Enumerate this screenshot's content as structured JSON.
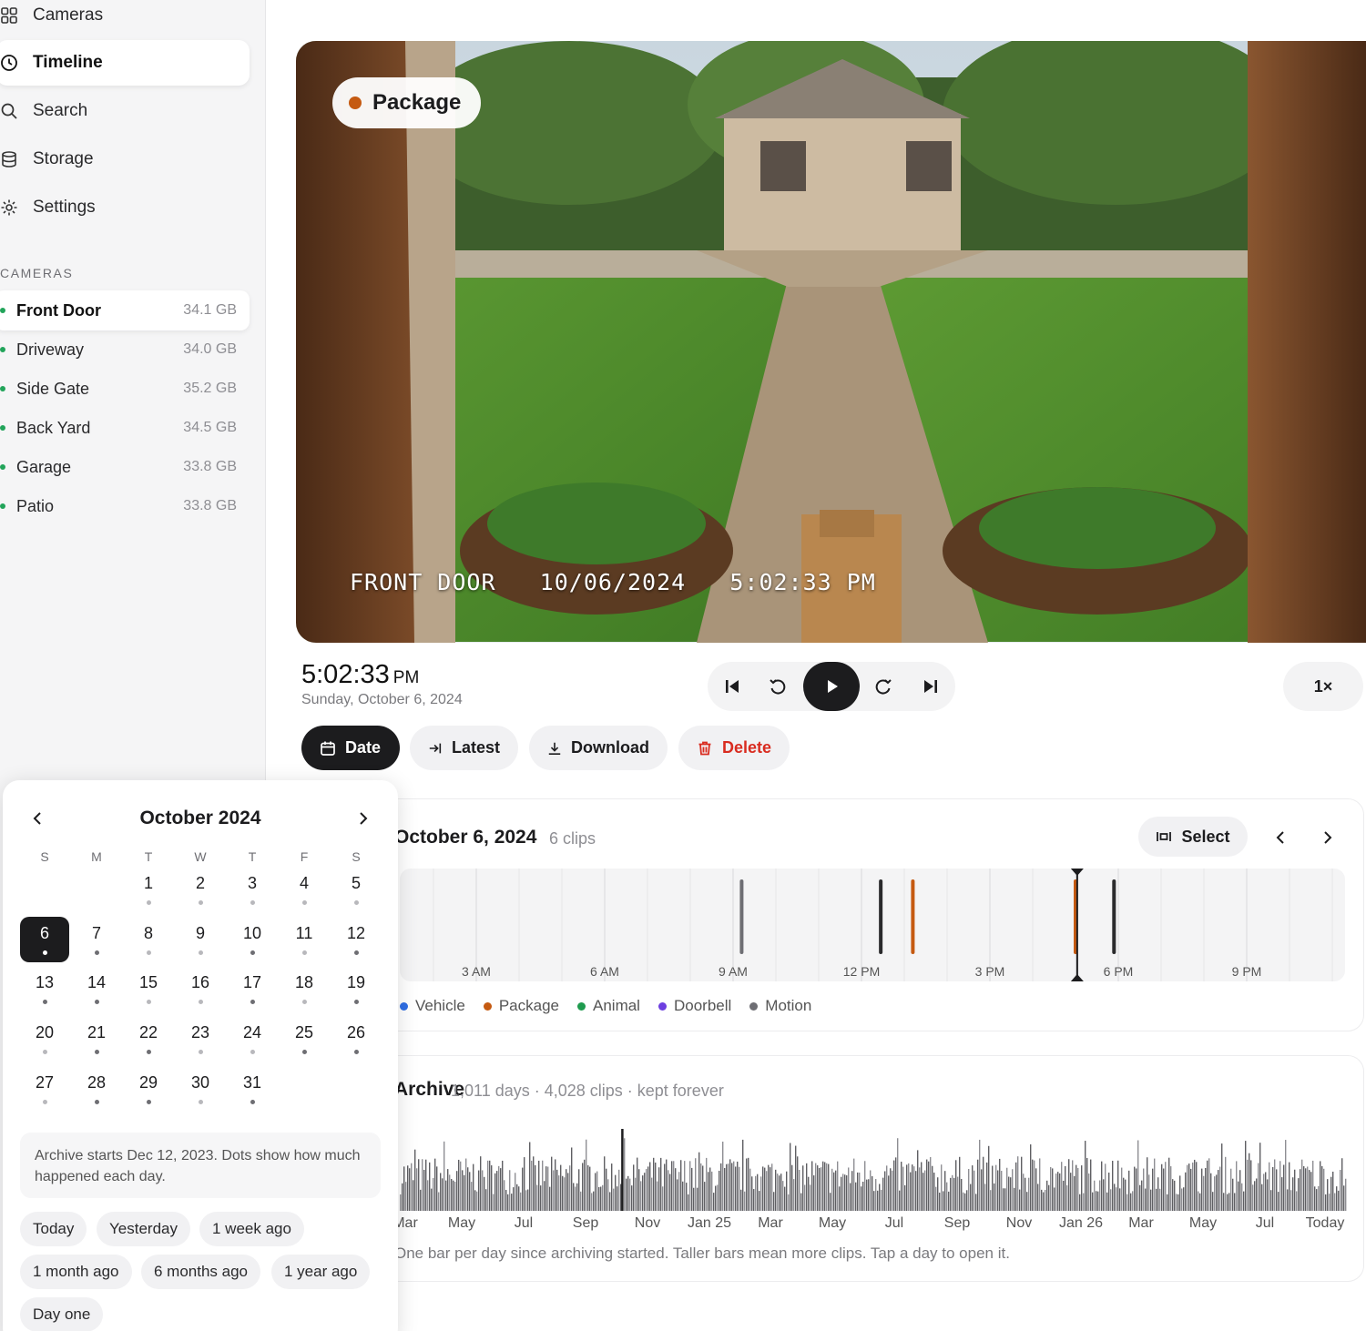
{
  "sidebar": {
    "nav": [
      {
        "label": "Cameras",
        "icon": "grid-icon"
      },
      {
        "label": "Timeline",
        "icon": "clock-icon",
        "active": true
      },
      {
        "label": "Search",
        "icon": "search-icon"
      },
      {
        "label": "Storage",
        "icon": "database-icon"
      },
      {
        "label": "Settings",
        "icon": "gear-icon"
      }
    ],
    "section_title": "CAMERAS",
    "cameras": [
      {
        "name": "Front Door",
        "size": "34.1 GB",
        "active": true
      },
      {
        "name": "Driveway",
        "size": "34.0 GB"
      },
      {
        "name": "Side Gate",
        "size": "35.2 GB"
      },
      {
        "name": "Back Yard",
        "size": "34.5 GB"
      },
      {
        "name": "Garage",
        "size": "33.8 GB"
      },
      {
        "name": "Patio",
        "size": "33.8 GB"
      }
    ]
  },
  "video": {
    "badge": "Package",
    "badge_color": "#c55a11",
    "osd_camera": "FRONT DOOR",
    "osd_date": "10/06/2024",
    "osd_time": "5:02:33 PM"
  },
  "playback": {
    "time": "5:02:33",
    "ampm": "PM",
    "date": "Sunday, October 6, 2024",
    "speed": "1×"
  },
  "actions": {
    "date": "Date",
    "latest": "Latest",
    "download": "Download",
    "delete": "Delete"
  },
  "timeline": {
    "title": "October 6, 2024",
    "clips": "6 clips",
    "select": "Select",
    "ticks": [
      "3 AM",
      "6 AM",
      "9 AM",
      "12 PM",
      "3 PM",
      "6 PM",
      "9 PM"
    ],
    "events": [
      {
        "hour": 9.2,
        "type": "Motion"
      },
      {
        "hour": 12.45,
        "type": "Doorbell"
      },
      {
        "hour": 13.2,
        "type": "Package"
      },
      {
        "hour": 17.0,
        "type": "Package"
      },
      {
        "hour": 17.9,
        "type": "Doorbell"
      }
    ],
    "playhead_hour": 17.04,
    "legend": [
      {
        "label": "Vehicle",
        "color": "#2f6ee5"
      },
      {
        "label": "Package",
        "color": "#c55a11"
      },
      {
        "label": "Animal",
        "color": "#1f9b4f"
      },
      {
        "label": "Doorbell",
        "color": "#6d3fe0"
      },
      {
        "label": "Motion",
        "color": "#6e6e73"
      }
    ]
  },
  "archive": {
    "title": "Archive",
    "meta": "1,011 days · 4,028 clips · kept forever",
    "ticks": [
      "Mar",
      "May",
      "Jul",
      "Sep",
      "Nov",
      "Jan 25",
      "Mar",
      "May",
      "Jul",
      "Sep",
      "Nov",
      "Jan 26",
      "Mar",
      "May",
      "Jul",
      "Today"
    ],
    "footnote": "One bar per day since archiving started. Taller bars mean more clips. Tap a day to open it.",
    "selected_fraction": 0.235
  },
  "calendar": {
    "title": "October 2024",
    "weekdays": [
      "S",
      "M",
      "T",
      "W",
      "T",
      "F",
      "S"
    ],
    "first_weekday": 2,
    "days": 31,
    "selected": 6,
    "dot_levels": [
      0,
      0,
      0,
      0,
      0,
      0,
      2,
      2,
      1,
      1,
      2,
      1,
      2,
      2,
      2,
      1,
      1,
      2,
      1,
      2,
      1,
      2,
      2,
      1,
      1,
      2,
      2,
      1,
      2,
      2,
      1,
      2,
      1
    ],
    "note": "Archive starts Dec 12, 2023. Dots show how much happened each day.",
    "quick": [
      "Today",
      "Yesterday",
      "1 week ago",
      "1 month ago",
      "6 months ago",
      "1 year ago",
      "Day one"
    ]
  }
}
